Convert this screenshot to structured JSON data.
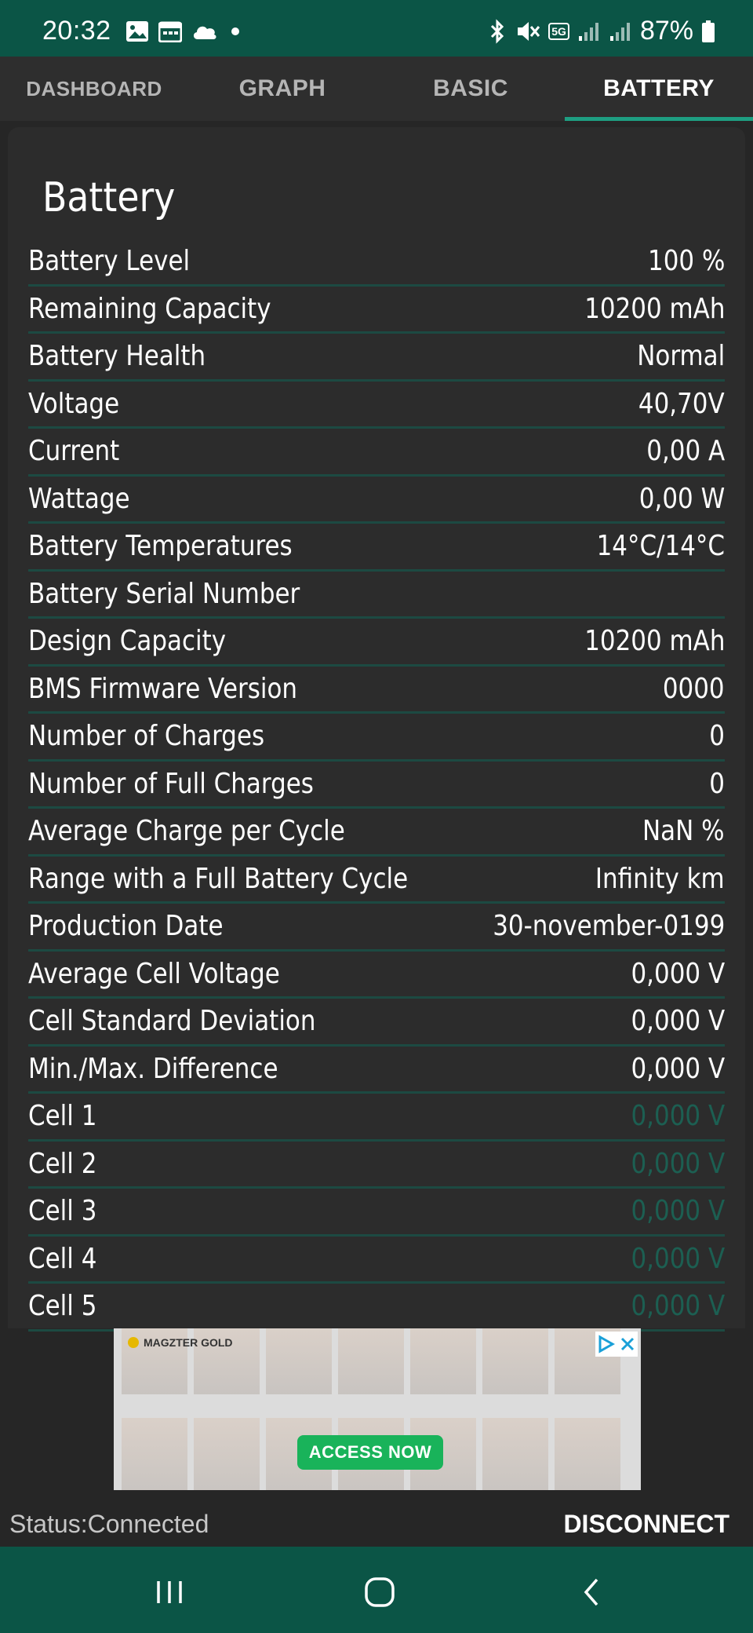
{
  "status_bar": {
    "time": "20:32",
    "battery_percent": "87%",
    "network": "5G",
    "left_icons": [
      "image-icon",
      "calendar-icon",
      "cloud-icon",
      "dot-icon"
    ],
    "right_icons": [
      "bluetooth-icon",
      "mute-icon",
      "5g-icon",
      "signal-icon",
      "signal-icon",
      "battery-icon"
    ]
  },
  "tabs": [
    {
      "label": "DASHBOARD",
      "active": false
    },
    {
      "label": "GRAPH",
      "active": false
    },
    {
      "label": "BASIC",
      "active": false
    },
    {
      "label": "BATTERY",
      "active": true
    }
  ],
  "card": {
    "title": "Battery",
    "rows": [
      {
        "label": "Battery Level",
        "value": "100 %"
      },
      {
        "label": "Remaining Capacity",
        "value": "10200 mAh"
      },
      {
        "label": "Battery Health",
        "value": "Normal"
      },
      {
        "label": "Voltage",
        "value": "40,70V"
      },
      {
        "label": "Current",
        "value": "0,00 A"
      },
      {
        "label": "Wattage",
        "value": "0,00 W"
      },
      {
        "label": "Battery Temperatures",
        "value": "14°C/14°C"
      },
      {
        "label": "Battery Serial Number",
        "value": ""
      },
      {
        "label": "Design Capacity",
        "value": "10200 mAh"
      },
      {
        "label": "BMS Firmware Version",
        "value": "0000"
      },
      {
        "label": "Number of Charges",
        "value": "0"
      },
      {
        "label": "Number of Full Charges",
        "value": "0"
      },
      {
        "label": "Average Charge per Cycle",
        "value": "NaN %"
      },
      {
        "label": "Range with a Full Battery Cycle",
        "value": "Infinity km"
      },
      {
        "label": "Production Date",
        "value": "30-november-0199"
      },
      {
        "label": "Average Cell Voltage",
        "value": "0,000 V"
      },
      {
        "label": "Cell Standard Deviation",
        "value": "0,000 V"
      },
      {
        "label": "Min./Max. Difference",
        "value": "0,000 V"
      },
      {
        "label": "Cell 1",
        "value": "0,000 V"
      },
      {
        "label": "Cell 2",
        "value": "0,000 V"
      },
      {
        "label": "Cell 3",
        "value": "0,000 V"
      },
      {
        "label": "Cell 4",
        "value": "0,000 V"
      },
      {
        "label": "Cell 5",
        "value": "0,000 V"
      }
    ]
  },
  "ad": {
    "brand": "MAGZTER GOLD",
    "button_label": "ACCESS NOW"
  },
  "footer": {
    "status": "Status:Connected",
    "disconnect_label": "DISCONNECT"
  },
  "colors": {
    "primary_dark": "#0b5546",
    "accent": "#1e9e82",
    "row_divider": "#1c4a42",
    "cell_value": "#1c5f52",
    "background": "#262626",
    "card": "#2c2c2c",
    "ad_button": "#19b35a"
  }
}
